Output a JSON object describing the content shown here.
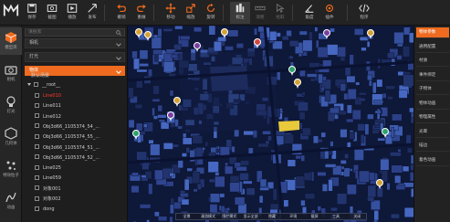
{
  "toolbar": {
    "tools": [
      {
        "label": "保存",
        "icon": "save-icon",
        "dim": false
      },
      {
        "label": "截图",
        "icon": "screenshot-icon",
        "dim": false
      },
      {
        "label": "播放",
        "icon": "play-icon",
        "dim": false
      },
      {
        "label": "发布",
        "icon": "publish-icon",
        "dim": false
      },
      {
        "label": "撤销",
        "icon": "undo-icon",
        "dim": false
      },
      {
        "label": "重做",
        "icon": "redo-icon",
        "dim": false
      },
      {
        "label": "移动",
        "icon": "move-icon",
        "dim": false
      },
      {
        "label": "缩放",
        "icon": "scale-icon",
        "dim": false
      },
      {
        "label": "旋转",
        "icon": "rotate-icon",
        "dim": false
      },
      {
        "label": "标注",
        "icon": "annotate-icon",
        "dim": false
      },
      {
        "label": "测距",
        "icon": "measure-icon",
        "dim": true
      },
      {
        "label": "拾取",
        "icon": "pick-icon",
        "dim": true
      },
      {
        "label": "角度",
        "icon": "angle-icon",
        "dim": false
      },
      {
        "label": "插件",
        "icon": "plugin-icon",
        "dim": false
      },
      {
        "label": "程序",
        "icon": "code-icon",
        "dim": false
      }
    ]
  },
  "left_strip": {
    "items": [
      {
        "label": "模型库",
        "icon": "cube-icon"
      },
      {
        "label": "相机",
        "icon": "camera-icon"
      },
      {
        "label": "灯光",
        "icon": "light-icon"
      },
      {
        "label": "几何体",
        "icon": "geometry-icon"
      },
      {
        "label": "特效粒子",
        "icon": "particle-icon"
      },
      {
        "label": "动画",
        "icon": "animation-icon"
      }
    ]
  },
  "panel": {
    "search_placeholder": "请搜索",
    "categories": [
      {
        "label": "相机",
        "active": false
      },
      {
        "label": "灯光",
        "active": false
      },
      {
        "label": "物体",
        "active": true
      }
    ],
    "root_label": "默认场景",
    "root_child": "__root__",
    "nodes": [
      {
        "label": "Line010",
        "highlight": true
      },
      {
        "label": "Line011",
        "highlight": false
      },
      {
        "label": "Line012",
        "highlight": false
      },
      {
        "label": "Obj3d66_1105374_54_...",
        "highlight": false
      },
      {
        "label": "Obj3d66_1105374_55_...",
        "highlight": false
      },
      {
        "label": "Obj3d66_1105374_51_...",
        "highlight": false
      },
      {
        "label": "Obj3d66_1105374_52_...",
        "highlight": false
      },
      {
        "label": "Line025",
        "highlight": false
      },
      {
        "label": "Line059",
        "highlight": false
      },
      {
        "label": "对象001",
        "highlight": false
      },
      {
        "label": "对象002",
        "highlight": false
      },
      {
        "label": "dong",
        "highlight": false
      }
    ]
  },
  "viewport": {
    "bottom_buttons": [
      "全景",
      "漫游模式",
      "围栏模式",
      "显示全部",
      "隐藏",
      "环境",
      "截屏",
      "工具",
      "关闭"
    ]
  },
  "right_panel": {
    "tabs": [
      {
        "label": "物体参数",
        "active": true
      },
      {
        "label": "通用配置",
        "active": false
      },
      {
        "label": "材质",
        "active": false
      },
      {
        "label": "事件绑定",
        "active": false
      },
      {
        "label": "子物体",
        "active": false
      },
      {
        "label": "物体动画",
        "active": false
      },
      {
        "label": "物理属性",
        "active": false
      },
      {
        "label": "光晕",
        "active": false
      },
      {
        "label": "描边",
        "active": false
      },
      {
        "label": "着色动画",
        "active": false
      }
    ]
  },
  "colors": {
    "accent": "#ee6b1f",
    "highlight_text": "#ff3b2f",
    "viewport_bg": "#0c1430"
  }
}
